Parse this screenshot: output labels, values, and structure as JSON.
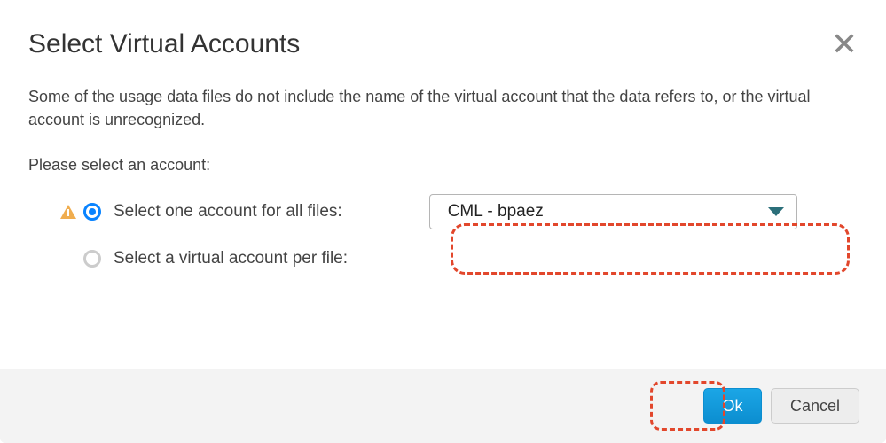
{
  "header": {
    "title": "Select Virtual Accounts",
    "close_glyph": "✕"
  },
  "body": {
    "description": "Some of the usage data files do not include the name of the virtual account that the data refers to, or the virtual account is unrecognized.",
    "prompt": "Please select an account:",
    "options": {
      "one_for_all": {
        "label": "Select one account for all files:",
        "selected": true,
        "warning": true
      },
      "per_file": {
        "label": "Select a virtual account per file:",
        "selected": false,
        "warning": false
      }
    },
    "dropdown": {
      "selected_value": "CML - bpaez"
    }
  },
  "footer": {
    "ok_label": "Ok",
    "cancel_label": "Cancel"
  },
  "colors": {
    "accent": "#0a84ff",
    "ok_button": "#1199dd",
    "highlight": "#e2472c",
    "warning": "#f0ad4e"
  }
}
